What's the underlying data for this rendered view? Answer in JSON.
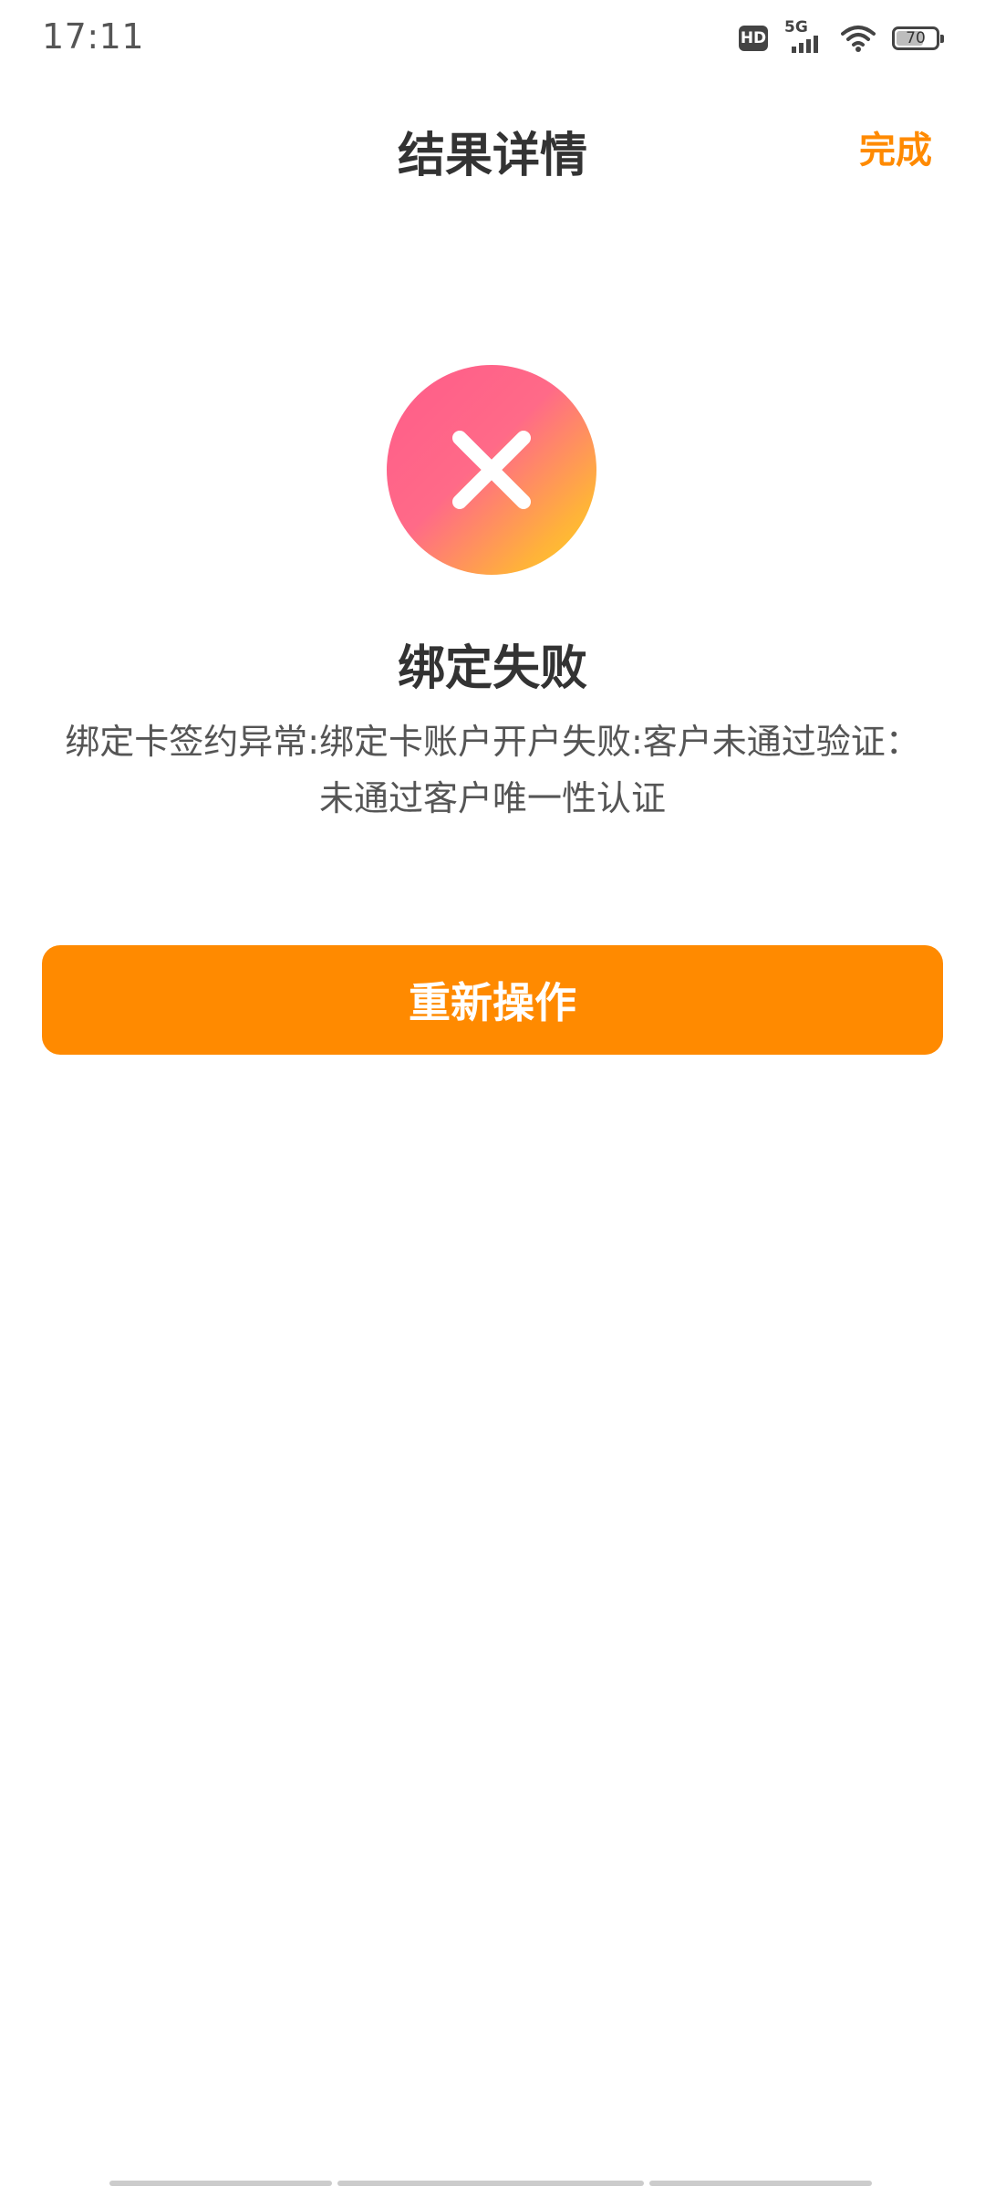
{
  "status_bar": {
    "time": "17:11",
    "hd_label": "HD",
    "network_label": "5G",
    "battery_level": "70",
    "battery_fraction": 0.7
  },
  "header": {
    "title": "结果详情",
    "done_label": "完成"
  },
  "result": {
    "icon": "error-x-icon",
    "title": "绑定失败",
    "message_line1": "绑定卡签约异常:绑定卡账户开户失败:客户未通过验证：",
    "message_line2": "未通过客户唯一性认证"
  },
  "actions": {
    "retry_label": "重新操作"
  },
  "colors": {
    "accent": "#FF8A00",
    "error_gradient_start": "#FF5C8A",
    "error_gradient_end": "#FFD21F",
    "text_primary": "#333333",
    "text_secondary": "#555555"
  }
}
